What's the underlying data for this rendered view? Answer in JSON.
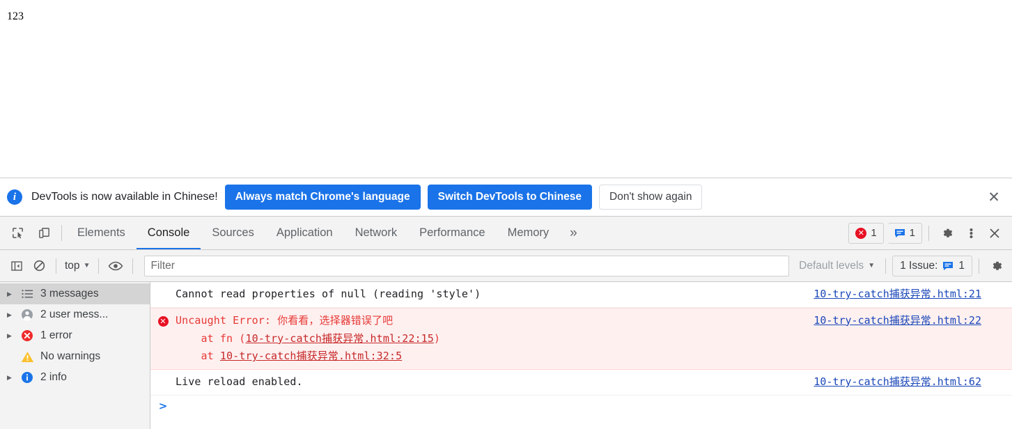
{
  "page": {
    "content_text": "123"
  },
  "language_banner": {
    "icon": "info-icon",
    "message": "DevTools is now available in Chinese!",
    "primary_button": "Always match Chrome's language",
    "secondary_button": "Switch DevTools to Chinese",
    "dismiss_button": "Don't show again",
    "close_icon": "✕",
    "accent_color": "#1a73e8"
  },
  "tabstrip": {
    "inspect_icon": "inspect-element-icon",
    "device_icon": "device-toolbar-icon",
    "tabs": [
      {
        "label": "Elements",
        "selected": false
      },
      {
        "label": "Console",
        "selected": true
      },
      {
        "label": "Sources",
        "selected": false
      },
      {
        "label": "Application",
        "selected": false
      },
      {
        "label": "Network",
        "selected": false
      },
      {
        "label": "Performance",
        "selected": false
      },
      {
        "label": "Memory",
        "selected": false
      }
    ],
    "more_tabs_icon": "»",
    "error_count": "1",
    "message_count": "1",
    "settings_icon": "gear-icon",
    "more_options_icon": "kebab-menu-icon",
    "close_icon": "✕",
    "error_color": "#e81123",
    "message_color": "#1a73e8"
  },
  "filterbar": {
    "sidebar_toggle_icon": "console-sidebar-toggle-icon",
    "clear_icon": "clear-console-icon",
    "context_value": "top",
    "context_caret": "▼",
    "eye_icon": "live-expression-icon",
    "filter_placeholder": "Filter",
    "filter_value": "",
    "levels_value": "Default levels",
    "levels_caret": "▼",
    "issues_label": "1 Issue:",
    "issues_count": "1",
    "settings_icon": "gear-icon"
  },
  "sidebar": {
    "items": [
      {
        "label": "3 messages",
        "icon": "list-icon",
        "selected": true,
        "expandable": true
      },
      {
        "label": "2 user mess...",
        "icon": "user-icon",
        "selected": false,
        "expandable": true
      },
      {
        "label": "1 error",
        "icon": "error-icon",
        "selected": false,
        "expandable": true
      },
      {
        "label": "No warnings",
        "icon": "warning-icon",
        "selected": false,
        "expandable": false
      },
      {
        "label": "2 info",
        "icon": "info-icon",
        "selected": false,
        "expandable": true
      }
    ]
  },
  "console": {
    "rows": [
      {
        "level": "log",
        "text": "Cannot read properties of null (reading 'style')",
        "source_link": "10-try-catch捕获异常.html:21"
      },
      {
        "level": "error",
        "text_line1": "Uncaught Error: 你看看，选择器错误了吧",
        "stack_line1_prefix": "    at fn (",
        "stack_line1_link": "10-try-catch捕获异常.html:22:15",
        "stack_line1_suffix": ")",
        "stack_line2_prefix": "    at ",
        "stack_line2_link": "10-try-catch捕获异常.html:32:5",
        "source_link": "10-try-catch捕获异常.html:22"
      },
      {
        "level": "log",
        "text": "Live reload enabled.",
        "source_link": "10-try-catch捕获异常.html:62"
      }
    ],
    "prompt_caret": ">",
    "prompt_value": ""
  }
}
